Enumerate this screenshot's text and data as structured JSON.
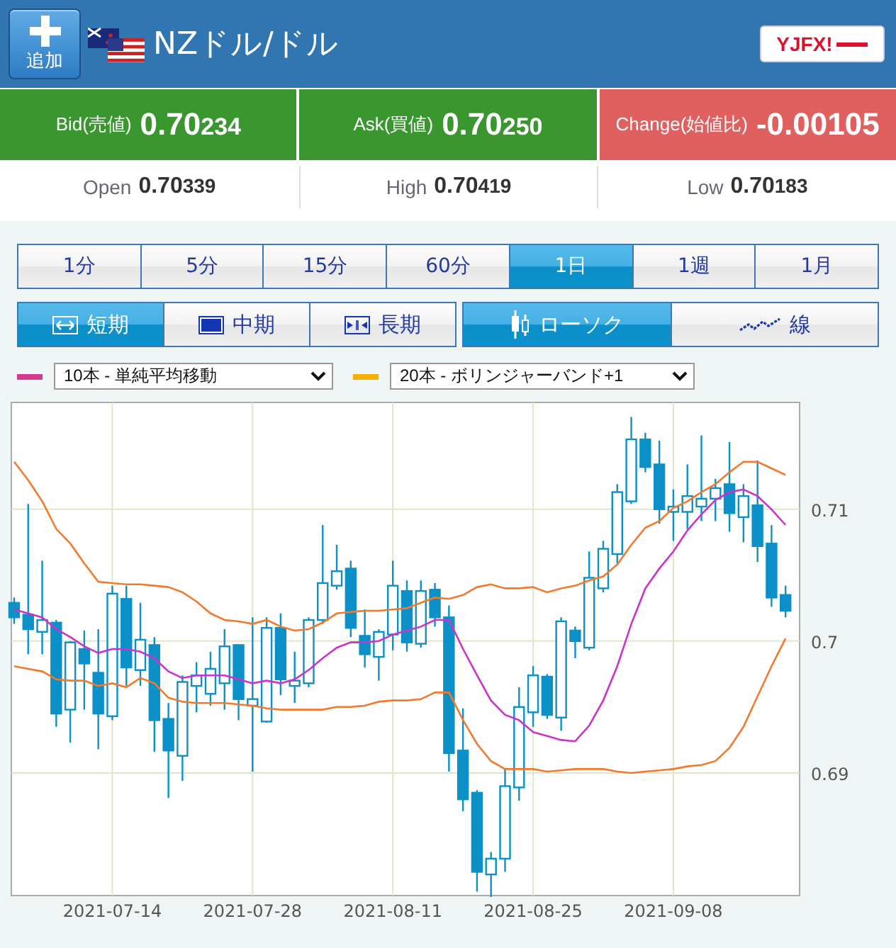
{
  "header": {
    "add_button": "追加",
    "title": "NZドル/ドル",
    "logo": "YJFX!"
  },
  "quotes": [
    {
      "kind": "bid",
      "label": "Bid(売値)",
      "big": "0.70",
      "small": "234"
    },
    {
      "kind": "ask",
      "label": "Ask(買値)",
      "big": "0.70",
      "small": "250"
    },
    {
      "kind": "change",
      "label": "Change(始値比)",
      "big": "-0.00105"
    }
  ],
  "stats": [
    {
      "label": "Open",
      "big": "0.70",
      "small": "339"
    },
    {
      "label": "High",
      "big": "0.70",
      "small": "419"
    },
    {
      "label": "Low",
      "big": "0.70",
      "small": "183"
    }
  ],
  "periods": [
    {
      "label": "1分",
      "selected": false
    },
    {
      "label": "5分",
      "selected": false
    },
    {
      "label": "15分",
      "selected": false
    },
    {
      "label": "60分",
      "selected": false
    },
    {
      "label": "1日",
      "selected": true
    },
    {
      "label": "1週",
      "selected": false
    },
    {
      "label": "1月",
      "selected": false
    }
  ],
  "ranges": [
    {
      "kind": "short",
      "label": "短期",
      "selected": true
    },
    {
      "kind": "medium",
      "label": "中期",
      "selected": false
    },
    {
      "kind": "long",
      "label": "長期",
      "selected": false
    }
  ],
  "chart_types": [
    {
      "kind": "candle",
      "label": "ローソク",
      "selected": true
    },
    {
      "kind": "line",
      "label": "線",
      "selected": false
    }
  ],
  "indicators": [
    {
      "color": "#d63a8e",
      "value": "10本 - 単純平均移動"
    },
    {
      "color": "#f5b000",
      "value": "20本 - ボリンジャーバンド+1"
    }
  ],
  "chart": {
    "chart_data": {
      "type": "candlestick",
      "grid": true,
      "ylim": [
        0.6807,
        0.7181
      ],
      "yticks": [
        0.69,
        0.7,
        0.71
      ],
      "categories": [
        null,
        null,
        null,
        null,
        null,
        null,
        null,
        "2021-07-14",
        null,
        null,
        null,
        null,
        null,
        null,
        null,
        null,
        null,
        "2021-07-28",
        null,
        null,
        null,
        null,
        null,
        null,
        null,
        null,
        null,
        "2021-08-11",
        null,
        null,
        null,
        null,
        null,
        null,
        null,
        null,
        null,
        "2021-08-25",
        null,
        null,
        null,
        null,
        null,
        null,
        null,
        null,
        null,
        "2021-09-08",
        null,
        null,
        null,
        null,
        null,
        null,
        null,
        null
      ],
      "series": [
        {
          "type": "line",
          "color": "#cc33cc",
          "values": [
            0.7024,
            0.7021,
            0.7018,
            0.7009,
            0.7003,
            0.6996,
            0.6991,
            0.6994,
            0.6994,
            0.6992,
            0.6987,
            0.6977,
            0.6972,
            0.6974,
            0.6974,
            0.6974,
            0.6971,
            0.6968,
            0.697,
            0.6968,
            0.6971,
            0.6978,
            0.6987,
            0.6995,
            0.6999,
            0.6999,
            0.7,
            0.7005,
            0.7008,
            0.7011,
            0.7016,
            0.7016,
            0.6994,
            0.6974,
            0.6955,
            0.6944,
            0.694,
            0.6931,
            0.6928,
            0.6925,
            0.6924,
            0.6936,
            0.6955,
            0.6981,
            0.7013,
            0.704,
            0.7055,
            0.7068,
            0.7084,
            0.7096,
            0.7107,
            0.7113,
            0.7115,
            0.711,
            0.71,
            0.7088
          ]
        },
        {
          "type": "line",
          "color": "#f27a2e",
          "values": [
            0.7136,
            0.7122,
            0.7106,
            0.7085,
            0.7074,
            0.7059,
            0.7045,
            0.7044,
            0.7043,
            0.7043,
            0.7042,
            0.7041,
            0.7037,
            0.703,
            0.7021,
            0.7016,
            0.7015,
            0.7013,
            0.7016,
            0.7011,
            0.7008,
            0.7009,
            0.7014,
            0.7021,
            0.7022,
            0.7023,
            0.7023,
            0.7024,
            0.7025,
            0.7029,
            0.7033,
            0.7032,
            0.7035,
            0.7041,
            0.7043,
            0.704,
            0.704,
            0.7041,
            0.7037,
            0.704,
            0.7042,
            0.7046,
            0.7049,
            0.7058,
            0.7073,
            0.7086,
            0.7091,
            0.7101,
            0.7106,
            0.7113,
            0.7119,
            0.7128,
            0.7136,
            0.7136,
            0.7131,
            0.7126
          ]
        },
        {
          "type": "line",
          "color": "#f27a2e",
          "values": [
            0.6981,
            0.6979,
            0.6977,
            0.6971,
            0.697,
            0.697,
            0.6966,
            0.6968,
            0.6965,
            0.6972,
            0.6968,
            0.6957,
            0.6954,
            0.6953,
            0.6953,
            0.6953,
            0.6952,
            0.6951,
            0.6949,
            0.6948,
            0.6948,
            0.6948,
            0.6948,
            0.695,
            0.695,
            0.6951,
            0.6954,
            0.6955,
            0.6955,
            0.6956,
            0.6961,
            0.6961,
            0.694,
            0.6922,
            0.6909,
            0.6903,
            0.6903,
            0.6903,
            0.6901,
            0.6902,
            0.6903,
            0.6903,
            0.6903,
            0.6901,
            0.69,
            0.6901,
            0.6902,
            0.6903,
            0.6905,
            0.6906,
            0.6909,
            0.6919,
            0.6935,
            0.6958,
            0.6981,
            0.7002
          ]
        }
      ],
      "ohlc": [
        [
          0.7029,
          0.7033,
          0.7013,
          0.7018
        ],
        [
          0.702,
          0.7104,
          0.699,
          0.7009
        ],
        [
          0.7007,
          0.7061,
          0.699,
          0.7016
        ],
        [
          0.7014,
          0.7016,
          0.6935,
          0.6945
        ],
        [
          0.6948,
          0.7,
          0.6923,
          0.6999
        ],
        [
          0.6994,
          0.7008,
          0.6948,
          0.6983
        ],
        [
          0.6976,
          0.7009,
          0.6918,
          0.6945
        ],
        [
          0.6943,
          0.7042,
          0.694,
          0.7036
        ],
        [
          0.7032,
          0.7042,
          0.6966,
          0.698
        ],
        [
          0.6978,
          0.7029,
          0.6966,
          0.7001
        ],
        [
          0.6997,
          0.7003,
          0.6916,
          0.694
        ],
        [
          0.6941,
          0.6953,
          0.6881,
          0.6917
        ],
        [
          0.6913,
          0.6974,
          0.6894,
          0.6969
        ],
        [
          0.6966,
          0.6984,
          0.6946,
          0.6974
        ],
        [
          0.696,
          0.6992,
          0.6951,
          0.6979
        ],
        [
          0.6968,
          0.7009,
          0.6948,
          0.6996
        ],
        [
          0.6997,
          0.6997,
          0.694,
          0.6956
        ],
        [
          0.6951,
          0.7018,
          0.6901,
          0.6956
        ],
        [
          0.6939,
          0.7018,
          0.6938,
          0.701
        ],
        [
          0.701,
          0.7021,
          0.6959,
          0.6971
        ],
        [
          0.6966,
          0.6992,
          0.6953,
          0.697
        ],
        [
          0.6968,
          0.7018,
          0.6965,
          0.7016
        ],
        [
          0.7016,
          0.7088,
          0.7013,
          0.7044
        ],
        [
          0.7042,
          0.7073,
          0.7039,
          0.7053
        ],
        [
          0.7055,
          0.7061,
          0.7003,
          0.701
        ],
        [
          0.7004,
          0.7024,
          0.698,
          0.699
        ],
        [
          0.6988,
          0.7009,
          0.697,
          0.7007
        ],
        [
          0.7005,
          0.7061,
          0.6993,
          0.7042
        ],
        [
          0.7038,
          0.7046,
          0.6992,
          0.6999
        ],
        [
          0.6998,
          0.7046,
          0.6995,
          0.7038
        ],
        [
          0.7039,
          0.7044,
          0.7011,
          0.7018
        ],
        [
          0.7018,
          0.7027,
          0.6901,
          0.6915
        ],
        [
          0.6917,
          0.6949,
          0.6871,
          0.688
        ],
        [
          0.6885,
          0.6887,
          0.681,
          0.6825
        ],
        [
          0.6823,
          0.684,
          0.6806,
          0.6835
        ],
        [
          0.6835,
          0.6903,
          0.6825,
          0.689
        ],
        [
          0.6889,
          0.6965,
          0.6879,
          0.695
        ],
        [
          0.6946,
          0.6981,
          0.6935,
          0.6974
        ],
        [
          0.6973,
          0.6975,
          0.6941,
          0.6944
        ],
        [
          0.6942,
          0.7018,
          0.6932,
          0.7015
        ],
        [
          0.7008,
          0.7011,
          0.6987,
          0.7
        ],
        [
          0.6995,
          0.7068,
          0.6993,
          0.7048
        ],
        [
          0.704,
          0.7076,
          0.7037,
          0.707
        ],
        [
          0.7066,
          0.7119,
          0.7059,
          0.7113
        ],
        [
          0.7106,
          0.717,
          0.7104,
          0.7153
        ],
        [
          0.7153,
          0.7158,
          0.7128,
          0.7132
        ],
        [
          0.7134,
          0.7152,
          0.7089,
          0.71
        ],
        [
          0.7098,
          0.7115,
          0.7076,
          0.7102
        ],
        [
          0.7098,
          0.7134,
          0.7085,
          0.711
        ],
        [
          0.7102,
          0.7156,
          0.7091,
          0.7108
        ],
        [
          0.7108,
          0.7123,
          0.7091,
          0.7116
        ],
        [
          0.7119,
          0.7151,
          0.7083,
          0.7097
        ],
        [
          0.7094,
          0.7119,
          0.7075,
          0.711
        ],
        [
          0.7103,
          0.7137,
          0.706,
          0.7072
        ],
        [
          0.7074,
          0.7088,
          0.7026,
          0.7033
        ],
        [
          0.7035,
          0.7042,
          0.7018,
          0.7023
        ]
      ]
    }
  }
}
